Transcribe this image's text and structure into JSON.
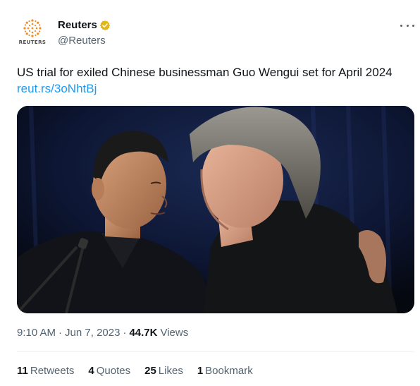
{
  "account": {
    "name": "Reuters",
    "handle": "@Reuters",
    "avatar_word": "REUTERS",
    "verified_badge_icon": "gold-verified-check-icon",
    "badge_color": "#e2b719"
  },
  "tweet": {
    "text": "US trial for exiled Chinese businessman Guo Wengui set for April 2024",
    "link": "reut.rs/3oNhtBj",
    "link_color": "#1d9bf0",
    "media": {
      "icon": "photo"
    }
  },
  "meta": {
    "time": "9:10 AM",
    "date": "Jun 7, 2023",
    "views_count": "44.7K",
    "views_label": "Views",
    "separator": "·"
  },
  "stats": [
    {
      "count": "11",
      "label": "Retweets"
    },
    {
      "count": "4",
      "label": "Quotes"
    },
    {
      "count": "25",
      "label": "Likes"
    },
    {
      "count": "1",
      "label": "Bookmark"
    }
  ],
  "more_icon": "more-horizontal-icon"
}
